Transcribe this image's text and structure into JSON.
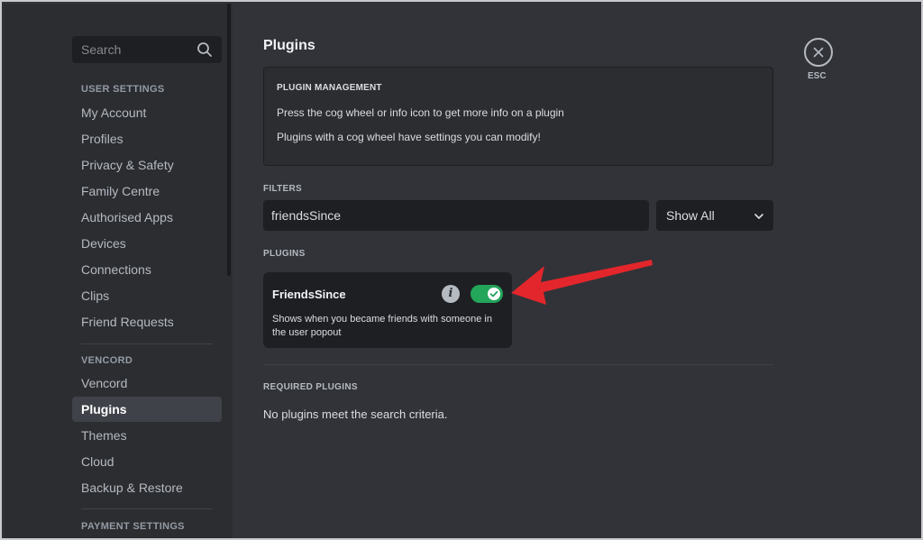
{
  "sidebar": {
    "search_placeholder": "Search",
    "user_settings_header": "USER SETTINGS",
    "user_items": [
      "My Account",
      "Profiles",
      "Privacy & Safety",
      "Family Centre",
      "Authorised Apps",
      "Devices",
      "Connections",
      "Clips",
      "Friend Requests"
    ],
    "vencord_header": "VENCORD",
    "vencord_items": [
      "Vencord",
      "Plugins",
      "Themes",
      "Cloud",
      "Backup & Restore"
    ],
    "active_item": "Plugins",
    "payment_header": "PAYMENT SETTINGS"
  },
  "main": {
    "title": "Plugins",
    "management": {
      "title": "PLUGIN MANAGEMENT",
      "line1": "Press the cog wheel or info icon to get more info on a plugin",
      "line2": "Plugins with a cog wheel have settings you can modify!"
    },
    "filters_label": "FILTERS",
    "filter_value": "friendsSince",
    "filter_select": "Show All",
    "plugins_label": "PLUGINS",
    "plugin": {
      "name": "FriendsSince",
      "description": "Shows when you became friends with someone in the user popout",
      "enabled": true,
      "info_icon": "i"
    },
    "required_label": "REQUIRED PLUGINS",
    "empty_message": "No plugins meet the search criteria."
  },
  "close": {
    "label": "ESC",
    "icon": "close-icon"
  },
  "colors": {
    "toggle_on": "#23a55a",
    "annotation_arrow": "#e3262b"
  }
}
